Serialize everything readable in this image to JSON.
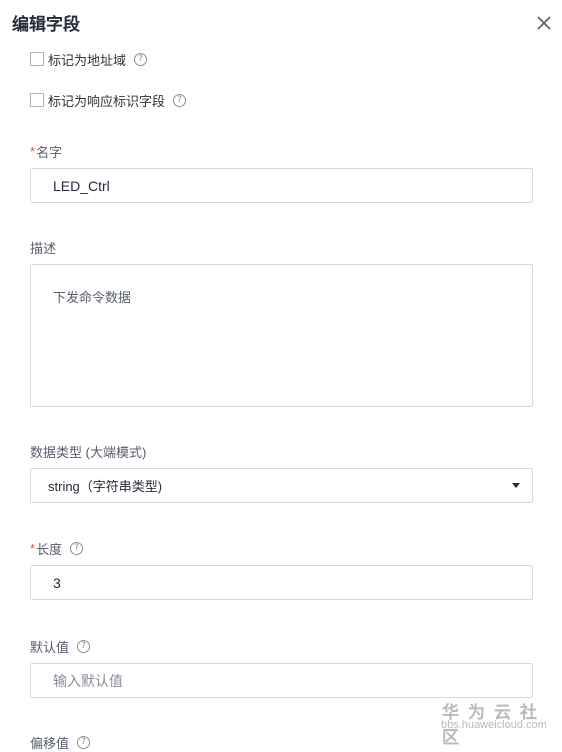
{
  "dialog": {
    "title": "编辑字段"
  },
  "checkboxes": [
    {
      "label": "标记为地址域",
      "checked": false
    },
    {
      "label": "标记为响应标识字段",
      "checked": false
    }
  ],
  "fields": {
    "name": {
      "required_mark": "*",
      "label": "名字",
      "value": "LED_Ctrl"
    },
    "description": {
      "label": "描述",
      "value": "下发命令数据"
    },
    "data_type": {
      "label": "数据类型 (大端模式)",
      "value": "string（字符串类型)"
    },
    "length": {
      "required_mark": "*",
      "label": "长度",
      "value": "3"
    },
    "default_value": {
      "label": "默认值",
      "placeholder": "输入默认值"
    },
    "offset_partial_label": "偏移值"
  },
  "help_glyph": "?",
  "watermark": {
    "brand": "华为云社区",
    "url": "bbs.huaweicloud.com"
  }
}
